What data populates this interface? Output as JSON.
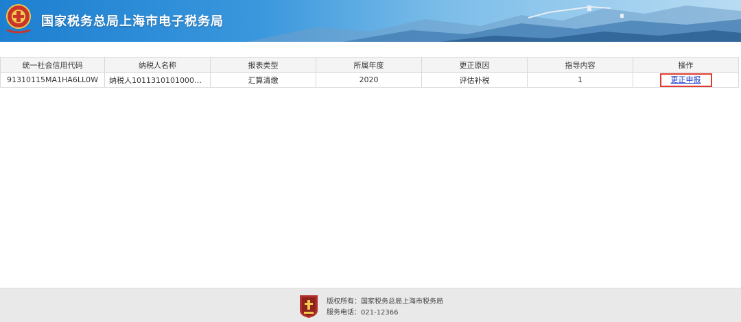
{
  "header": {
    "title": "国家税务总局上海市电子税务局"
  },
  "colors": {
    "header_start": "#1d7fd0",
    "header_end": "#b9dcf3",
    "link": "#1a3dcc",
    "highlight_border": "#e03a2f"
  },
  "table": {
    "columns": [
      "统一社会信用代码",
      "纳税人名称",
      "报表类型",
      "所属年度",
      "更正原因",
      "指导内容",
      "操作"
    ],
    "rows": [
      {
        "credit_code": "91310115MA1HA6LL0W",
        "taxpayer_name": "纳税人101131010100004405...",
        "report_type": "汇算清缴",
        "year": "2020",
        "reason": "评估补税",
        "guidance": "1",
        "action": "更正申报"
      }
    ]
  },
  "footer": {
    "copyright": "版权所有：国家税务总局上海市税务局",
    "phone": "服务电话：021-12366"
  }
}
